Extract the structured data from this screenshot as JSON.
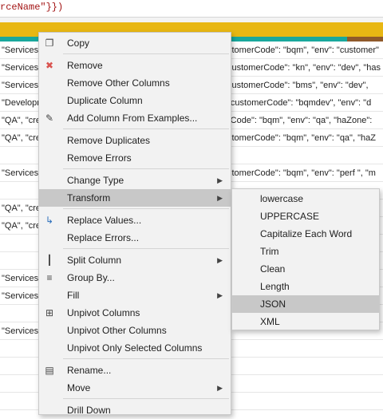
{
  "formula": {
    "text": "rceName\"}})"
  },
  "rows": [
    {
      "c1": "\"Services\"",
      "c2": "stomerCode\": \"bqm\",  \"env\": \"customer\""
    },
    {
      "c1": "\"Services\"",
      "c2": "customerCode\": \"kn\",  \"env\": \"dev\",  \"has"
    },
    {
      "c1": "\"Services\"",
      "c2": "customerCode\": \"bms\",  \"env\": \"dev\","
    },
    {
      "c1": "\"Developm",
      "c2": "\"customerCode\": \"bqmdev\",  \"env\": \"d"
    },
    {
      "c1": "\"QA\",  \"cre",
      "c2": "rCode\": \"bqm\",  \"env\": \"qa\",  \"haZone\":"
    },
    {
      "c1": "\"QA\",  \"cre",
      "c2": "stomerCode\": \"bqm\",  \"env\": \"qa\",  \"haZ"
    },
    {
      "c1": "",
      "c2": ""
    },
    {
      "c1": "\"Services\"",
      "c2": "stomerCode\": \"bqm\",  \"env\": \"perf \",  \"m"
    },
    {
      "c1": "",
      "c2": ""
    },
    {
      "c1": "\"QA\",  \"cre",
      "c2": ""
    },
    {
      "c1": "\"QA\",  \"cre",
      "c2": ""
    },
    {
      "c1": "",
      "c2": ""
    },
    {
      "c1": "",
      "c2": ""
    },
    {
      "c1": "\"Services\"",
      "c2": ""
    },
    {
      "c1": "\"Services\"",
      "c2": ""
    },
    {
      "c1": "",
      "c2": ""
    },
    {
      "c1": "\"Services\"",
      "c2": ""
    },
    {
      "c1": "",
      "c2": ""
    },
    {
      "c1": "",
      "c2": ""
    },
    {
      "c1": "",
      "c2": ""
    },
    {
      "c1": "",
      "c2": ""
    }
  ],
  "menu": {
    "copy": "Copy",
    "remove": "Remove",
    "remove_other_columns": "Remove Other Columns",
    "duplicate_column": "Duplicate Column",
    "add_column_from_examples": "Add Column From Examples...",
    "remove_duplicates": "Remove Duplicates",
    "remove_errors": "Remove Errors",
    "change_type": "Change Type",
    "transform": "Transform",
    "replace_values": "Replace Values...",
    "replace_errors": "Replace Errors...",
    "split_column": "Split Column",
    "group_by": "Group By...",
    "fill": "Fill",
    "unpivot_columns": "Unpivot Columns",
    "unpivot_other_columns": "Unpivot Other Columns",
    "unpivot_only_selected": "Unpivot Only Selected Columns",
    "rename": "Rename...",
    "move": "Move",
    "drill_down": "Drill Down"
  },
  "submenu": {
    "lowercase": "lowercase",
    "uppercase": "UPPERCASE",
    "capitalize": "Capitalize Each Word",
    "trim": "Trim",
    "clean": "Clean",
    "length": "Length",
    "json": "JSON",
    "xml": "XML"
  },
  "icons": {
    "copy": "copy-icon",
    "remove": "remove-icon",
    "add_column_from_examples": "add-column-icon",
    "replace_values": "replace-values-icon",
    "split_column": "split-column-icon",
    "group_by": "group-by-icon",
    "unpivot_columns": "unpivot-icon",
    "rename": "rename-icon"
  },
  "colors": {
    "header": "#e8b713",
    "quality_valid": "#19a89d",
    "quality_other": "#8f5a2b",
    "highlight": "#c8c8c8",
    "menu_bg": "#f2f2f2"
  }
}
